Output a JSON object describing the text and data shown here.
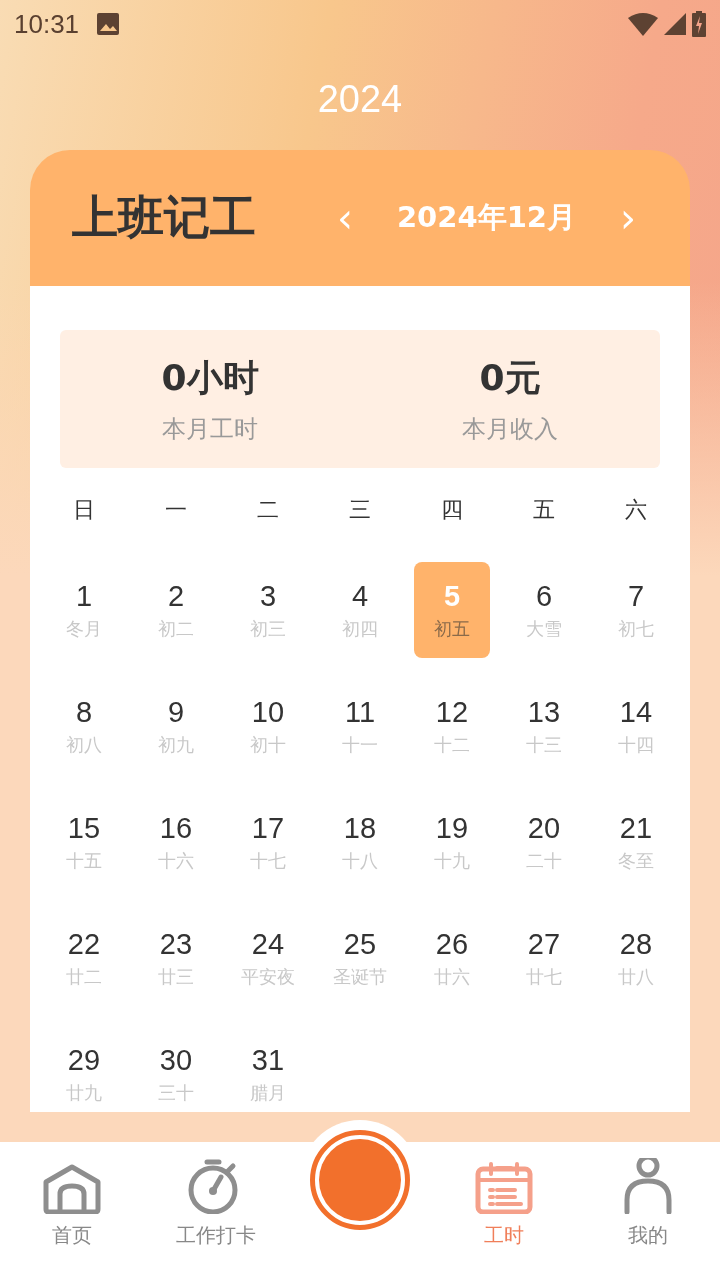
{
  "status_bar": {
    "time": "10:31"
  },
  "year_title": "2024",
  "card": {
    "title": "上班记工",
    "prev": "‹",
    "month": "2024年12月",
    "next": "›"
  },
  "summary": [
    {
      "value": "0小时",
      "label": "本月工时"
    },
    {
      "value": "0元",
      "label": "本月收入"
    }
  ],
  "weekdays": [
    "日",
    "一",
    "二",
    "三",
    "四",
    "五",
    "六"
  ],
  "days": [
    {
      "day": "1",
      "lunar": "冬月",
      "selected": false
    },
    {
      "day": "2",
      "lunar": "初二",
      "selected": false
    },
    {
      "day": "3",
      "lunar": "初三",
      "selected": false
    },
    {
      "day": "4",
      "lunar": "初四",
      "selected": false
    },
    {
      "day": "5",
      "lunar": "初五",
      "selected": true
    },
    {
      "day": "6",
      "lunar": "大雪",
      "selected": false
    },
    {
      "day": "7",
      "lunar": "初七",
      "selected": false
    },
    {
      "day": "8",
      "lunar": "初八",
      "selected": false
    },
    {
      "day": "9",
      "lunar": "初九",
      "selected": false
    },
    {
      "day": "10",
      "lunar": "初十",
      "selected": false
    },
    {
      "day": "11",
      "lunar": "十一",
      "selected": false
    },
    {
      "day": "12",
      "lunar": "十二",
      "selected": false
    },
    {
      "day": "13",
      "lunar": "十三",
      "selected": false
    },
    {
      "day": "14",
      "lunar": "十四",
      "selected": false
    },
    {
      "day": "15",
      "lunar": "十五",
      "selected": false
    },
    {
      "day": "16",
      "lunar": "十六",
      "selected": false
    },
    {
      "day": "17",
      "lunar": "十七",
      "selected": false
    },
    {
      "day": "18",
      "lunar": "十八",
      "selected": false
    },
    {
      "day": "19",
      "lunar": "十九",
      "selected": false
    },
    {
      "day": "20",
      "lunar": "二十",
      "selected": false
    },
    {
      "day": "21",
      "lunar": "冬至",
      "selected": false
    },
    {
      "day": "22",
      "lunar": "廿二",
      "selected": false
    },
    {
      "day": "23",
      "lunar": "廿三",
      "selected": false
    },
    {
      "day": "24",
      "lunar": "平安夜",
      "selected": false
    },
    {
      "day": "25",
      "lunar": "圣诞节",
      "selected": false
    },
    {
      "day": "26",
      "lunar": "廿六",
      "selected": false
    },
    {
      "day": "27",
      "lunar": "廿七",
      "selected": false
    },
    {
      "day": "28",
      "lunar": "廿八",
      "selected": false
    },
    {
      "day": "29",
      "lunar": "廿九",
      "selected": false
    },
    {
      "day": "30",
      "lunar": "三十",
      "selected": false
    },
    {
      "day": "31",
      "lunar": "腊月",
      "selected": false
    }
  ],
  "bottom_nav": [
    {
      "kind": "home",
      "label": "首页",
      "selected": false
    },
    {
      "kind": "timer",
      "label": "工作打卡",
      "selected": false
    },
    {
      "kind": "center",
      "selected": false
    },
    {
      "kind": "calendar",
      "label": "工时",
      "selected": true
    },
    {
      "kind": "person",
      "label": "我的",
      "selected": false
    }
  ]
}
